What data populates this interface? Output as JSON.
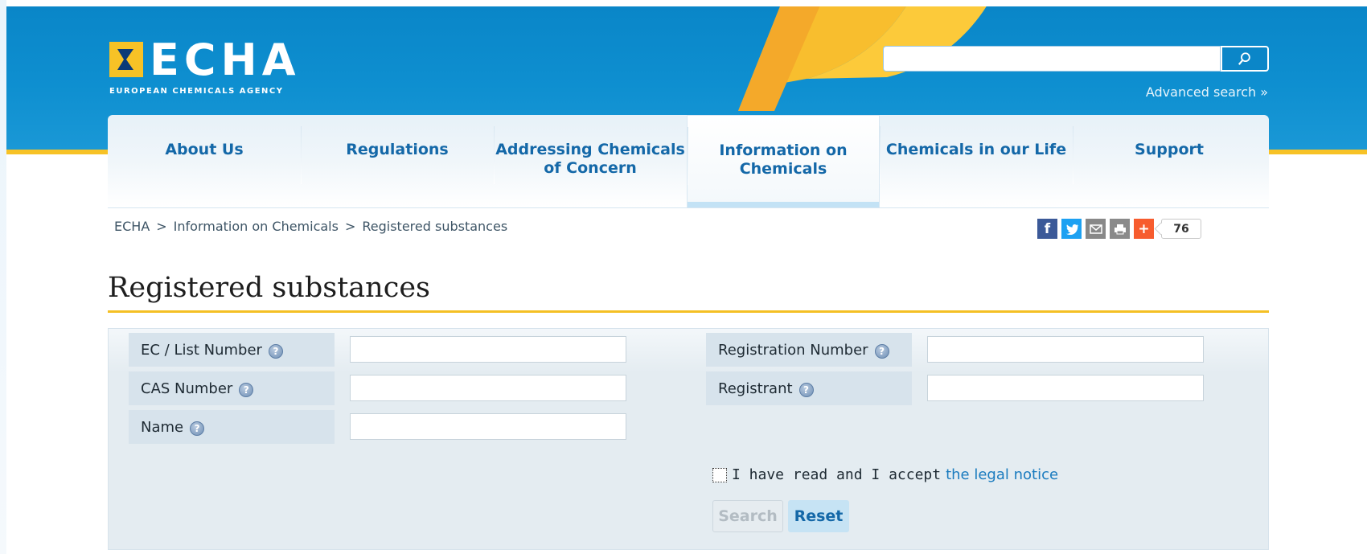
{
  "header": {
    "logo_text": "ECHA",
    "logo_subtitle": "EUROPEAN CHEMICALS AGENCY",
    "search": {
      "value": "",
      "placeholder": ""
    },
    "advanced_search": "Advanced search »"
  },
  "nav": {
    "items": [
      {
        "label": "About Us"
      },
      {
        "label": "Regulations"
      },
      {
        "label": "Addressing Chemicals of Concern"
      },
      {
        "label": "Information on Chemicals",
        "active": true
      },
      {
        "label": "Chemicals in our Life"
      },
      {
        "label": "Support"
      }
    ]
  },
  "breadcrumb": {
    "items": [
      "ECHA",
      "Information on Chemicals",
      "Registered substances"
    ],
    "separator": ">"
  },
  "share": {
    "icons": [
      "facebook-icon",
      "twitter-icon",
      "email-icon",
      "print-icon",
      "addthis-icon"
    ],
    "count": "76",
    "fb_glyph": "f",
    "add_glyph": "+"
  },
  "page": {
    "title": "Registered substances"
  },
  "form": {
    "fields": {
      "ec_list_number": {
        "label": "EC / List Number",
        "value": ""
      },
      "cas_number": {
        "label": "CAS Number",
        "value": ""
      },
      "name": {
        "label": "Name",
        "value": ""
      },
      "registration_number": {
        "label": "Registration Number",
        "value": ""
      },
      "registrant": {
        "label": "Registrant",
        "value": ""
      }
    },
    "legal": {
      "text": "I have read and I accept",
      "link": "the legal notice",
      "checked": false
    },
    "search_button": "Search",
    "reset_button": "Reset"
  },
  "colors": {
    "header_blue": "#0a86c8",
    "accent_yellow": "#f7c226",
    "nav_text": "#1468a8",
    "link": "#1a7bbf"
  }
}
